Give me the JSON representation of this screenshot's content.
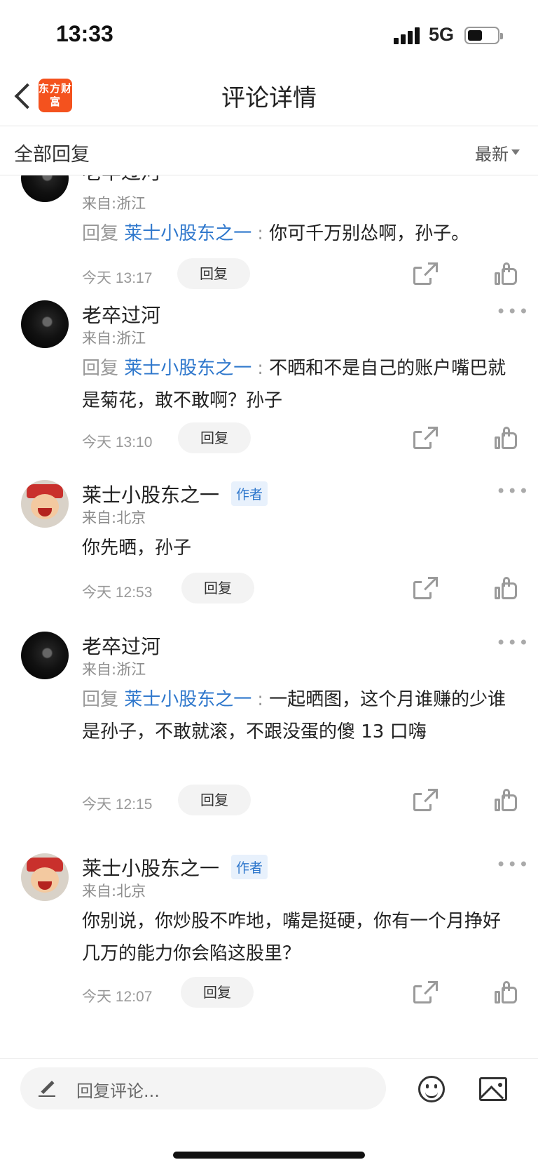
{
  "status_bar": {
    "time": "13:33",
    "network": "5G"
  },
  "header": {
    "logo_text": "东方财富",
    "title": "评论详情"
  },
  "filter": {
    "label": "全部回复",
    "sort": "最新"
  },
  "comments": [
    {
      "username": "老卒过河",
      "location": "来自:浙江",
      "reply_prefix": "回复",
      "reply_target": "莱士小股东之一",
      "text": "你可千万别怂啊，孙子。",
      "time": "今天 13:17",
      "reply_label": "回复"
    },
    {
      "username": "老卒过河",
      "location": "来自:浙江",
      "reply_prefix": "回复",
      "reply_target": "莱士小股东之一",
      "text": "不晒和不是自己的账户嘴巴就是菊花，敢不敢啊？孙子",
      "time": "今天 13:10",
      "reply_label": "回复"
    },
    {
      "username": "莱士小股东之一",
      "badge": "作者",
      "location": "来自:北京",
      "text": "你先晒，孙子",
      "time": "今天 12:53",
      "reply_label": "回复"
    },
    {
      "username": "老卒过河",
      "location": "来自:浙江",
      "reply_prefix": "回复",
      "reply_target": "莱士小股东之一",
      "text": "一起晒图，这个月谁赚的少谁是孙子，不敢就滚，不跟没蛋的傻 13 口嗨",
      "time": "今天 12:15",
      "reply_label": "回复"
    },
    {
      "username": "莱士小股东之一",
      "badge": "作者",
      "location": "来自:北京",
      "text": "你别说，你炒股不咋地，嘴是挺硬，你有一个月挣好几万的能力你会陷这股里？",
      "time": "今天 12:07",
      "reply_label": "回复"
    }
  ],
  "bottom_bar": {
    "placeholder": "回复评论..."
  },
  "colors": {
    "link": "#2e77cc",
    "logo": "#f4521e"
  }
}
